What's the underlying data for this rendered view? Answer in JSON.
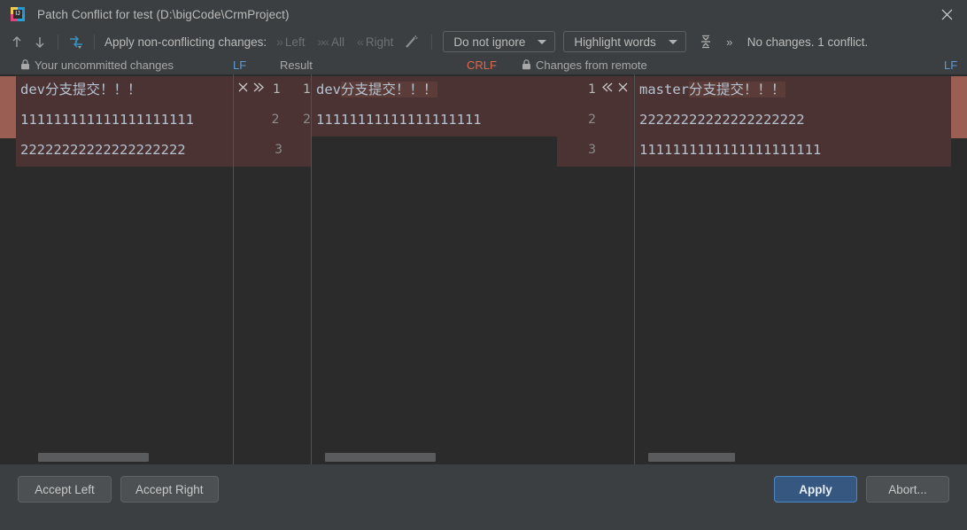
{
  "window": {
    "title": "Patch Conflict for test (D:\\bigCode\\CrmProject)",
    "icon": "intellij-idea-icon",
    "close_label": "close-icon"
  },
  "toolbar": {
    "prev_icon": "arrow-up-icon",
    "next_icon": "arrow-down-icon",
    "compare_icon": "apply-changes-icon",
    "apply_label": "Apply non-conflicting changes:",
    "actions": [
      {
        "id": "left",
        "label": "Left",
        "icon": "chevrons-right-icon",
        "enabled": false
      },
      {
        "id": "all",
        "label": "All",
        "icon": "chevrons-both-icon",
        "enabled": false
      },
      {
        "id": "right",
        "label": "Right",
        "icon": "chevrons-left-icon",
        "enabled": false
      }
    ],
    "magic_icon": "magic-wand-icon",
    "ignore_policy": {
      "value": "Do not ignore",
      "caret": "chevron-down-icon"
    },
    "highlight_policy": {
      "value": "Highlight words",
      "caret": "chevron-down-icon"
    },
    "collapse_icon": "collapse-unchanged-icon",
    "more_icon": "chevrons-right-small-icon",
    "status": "No changes. 1 conflict."
  },
  "headers": {
    "left": {
      "lock_icon": "lock-icon",
      "title": "Your uncommitted changes",
      "separator": "LF"
    },
    "result": {
      "title": "Result",
      "separator": "CRLF"
    },
    "right": {
      "lock_icon": "lock-icon",
      "title": "Changes from remote",
      "separator": "LF"
    }
  },
  "diff": {
    "left_pane": {
      "lines": [
        {
          "pre": "dev",
          "hl": "分支提交！！！",
          "conflict": true
        },
        {
          "pre": "111111111111111111111",
          "hl": "",
          "conflict": true
        },
        {
          "pre": "22222222222222222222",
          "hl": "",
          "conflict": false
        }
      ],
      "numbers": [
        "1",
        "2",
        "3"
      ]
    },
    "result_pane": {
      "lines": [
        {
          "pre": "dev",
          "hl": "分支提交！！！",
          "conflict": true
        },
        {
          "pre": "11111111111111111111",
          "hl": "",
          "conflict": true
        }
      ],
      "numbers_left": [
        "1",
        "2",
        "3"
      ],
      "numbers_right": [
        "1",
        "2"
      ]
    },
    "right_pane": {
      "lines": [
        {
          "pre": "master",
          "hl": "分支提交！！！",
          "conflict": true
        },
        {
          "pre": "22222222222222222222",
          "hl": "",
          "conflict": true
        },
        {
          "pre": "1111111111111111111111",
          "hl": "",
          "conflict": true
        }
      ],
      "numbers": [
        "1",
        "2",
        "3"
      ]
    },
    "left_gutter_icons": {
      "remove": "close-icon",
      "accept": "chevrons-right-icon"
    },
    "right_gutter_icons": {
      "accept": "chevrons-left-icon",
      "remove": "close-icon"
    }
  },
  "footer": {
    "accept_left": "Accept Left",
    "accept_right": "Accept Right",
    "apply": "Apply",
    "abort": "Abort..."
  },
  "colors": {
    "window_bg": "#3c3f41",
    "editor_bg": "#2b2b2b",
    "conflict_bg": "#4c3333",
    "conflict_marker": "#9a5f52",
    "word_highlight": "#5b3c38",
    "accent_blue": "#365880",
    "lf_blue": "#5c9ad2",
    "crlf_red": "#e0674e"
  }
}
